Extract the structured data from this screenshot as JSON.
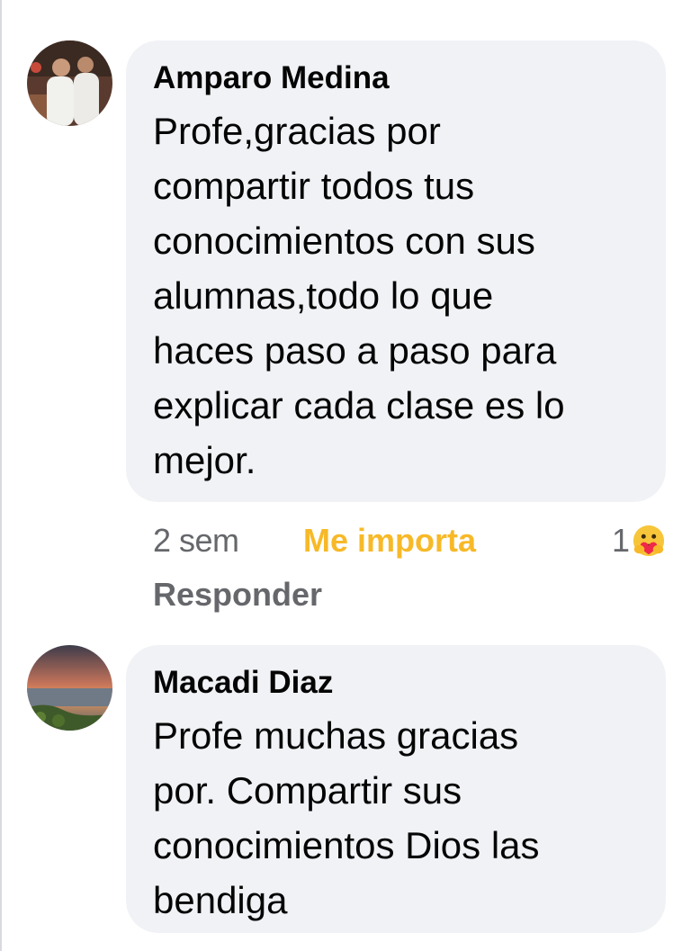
{
  "comments": [
    {
      "author": "Amparo Medina",
      "text": "Profe,gracias por\ncompartir todos tus\nconocimientos con sus\nalumnas,todo lo que\nhaces paso a paso para\nexplicar cada clase es lo\nmejor.",
      "time": "2 sem",
      "reaction_label": "Me importa",
      "reaction_count": "1",
      "reaction_icon": "care-emoji-icon",
      "reply_label": "Responder"
    },
    {
      "author": "Macadi Diaz",
      "text": "Profe muchas gracias\npor. Compartir sus\nconocimientos Dios las\nbendiga"
    }
  ],
  "colors": {
    "bubble": "#f0f2f5",
    "text": "#050505",
    "meta": "#65676b",
    "care": "#f7b928"
  }
}
